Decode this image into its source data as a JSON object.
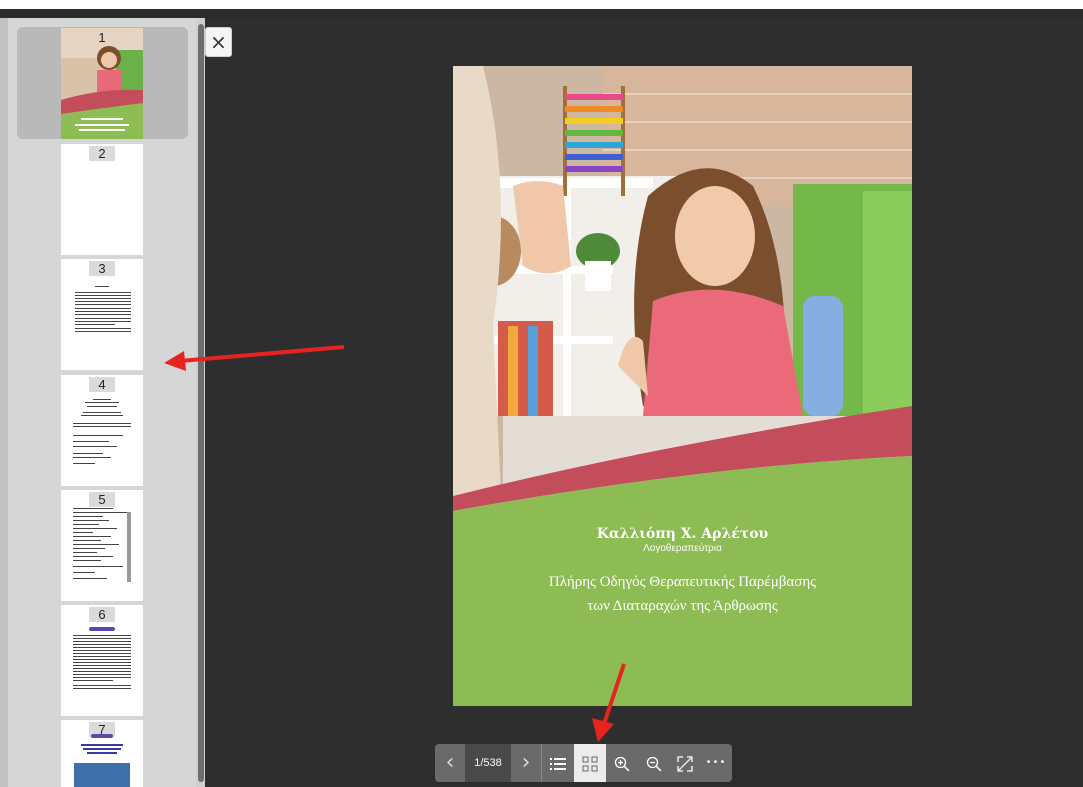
{
  "sidebar": {
    "thumbnails": [
      {
        "page": "1"
      },
      {
        "page": "2"
      },
      {
        "page": "3"
      },
      {
        "page": "4"
      },
      {
        "page": "5"
      },
      {
        "page": "6"
      },
      {
        "page": "7"
      }
    ]
  },
  "viewer": {
    "close_symbol": "×",
    "cover": {
      "author": "Καλλιόπη Χ. Αρλέτου",
      "role": "Λογοθεραπεύτρια",
      "title_line1": "Πλήρης Οδηγός Θεραπευτικής Παρέμβασης",
      "title_line2": "των Διαταραχών της Άρθρωσης"
    }
  },
  "toolbar": {
    "prev_symbol": "‹",
    "page_indicator": "1/538",
    "next_symbol": "›",
    "more_symbol": "•••"
  },
  "colors": {
    "cover_green": "#8dbb54",
    "cover_red": "#c44d5c",
    "annotation_arrow": "#e8231f",
    "viewer_background": "#2e2e2e"
  }
}
